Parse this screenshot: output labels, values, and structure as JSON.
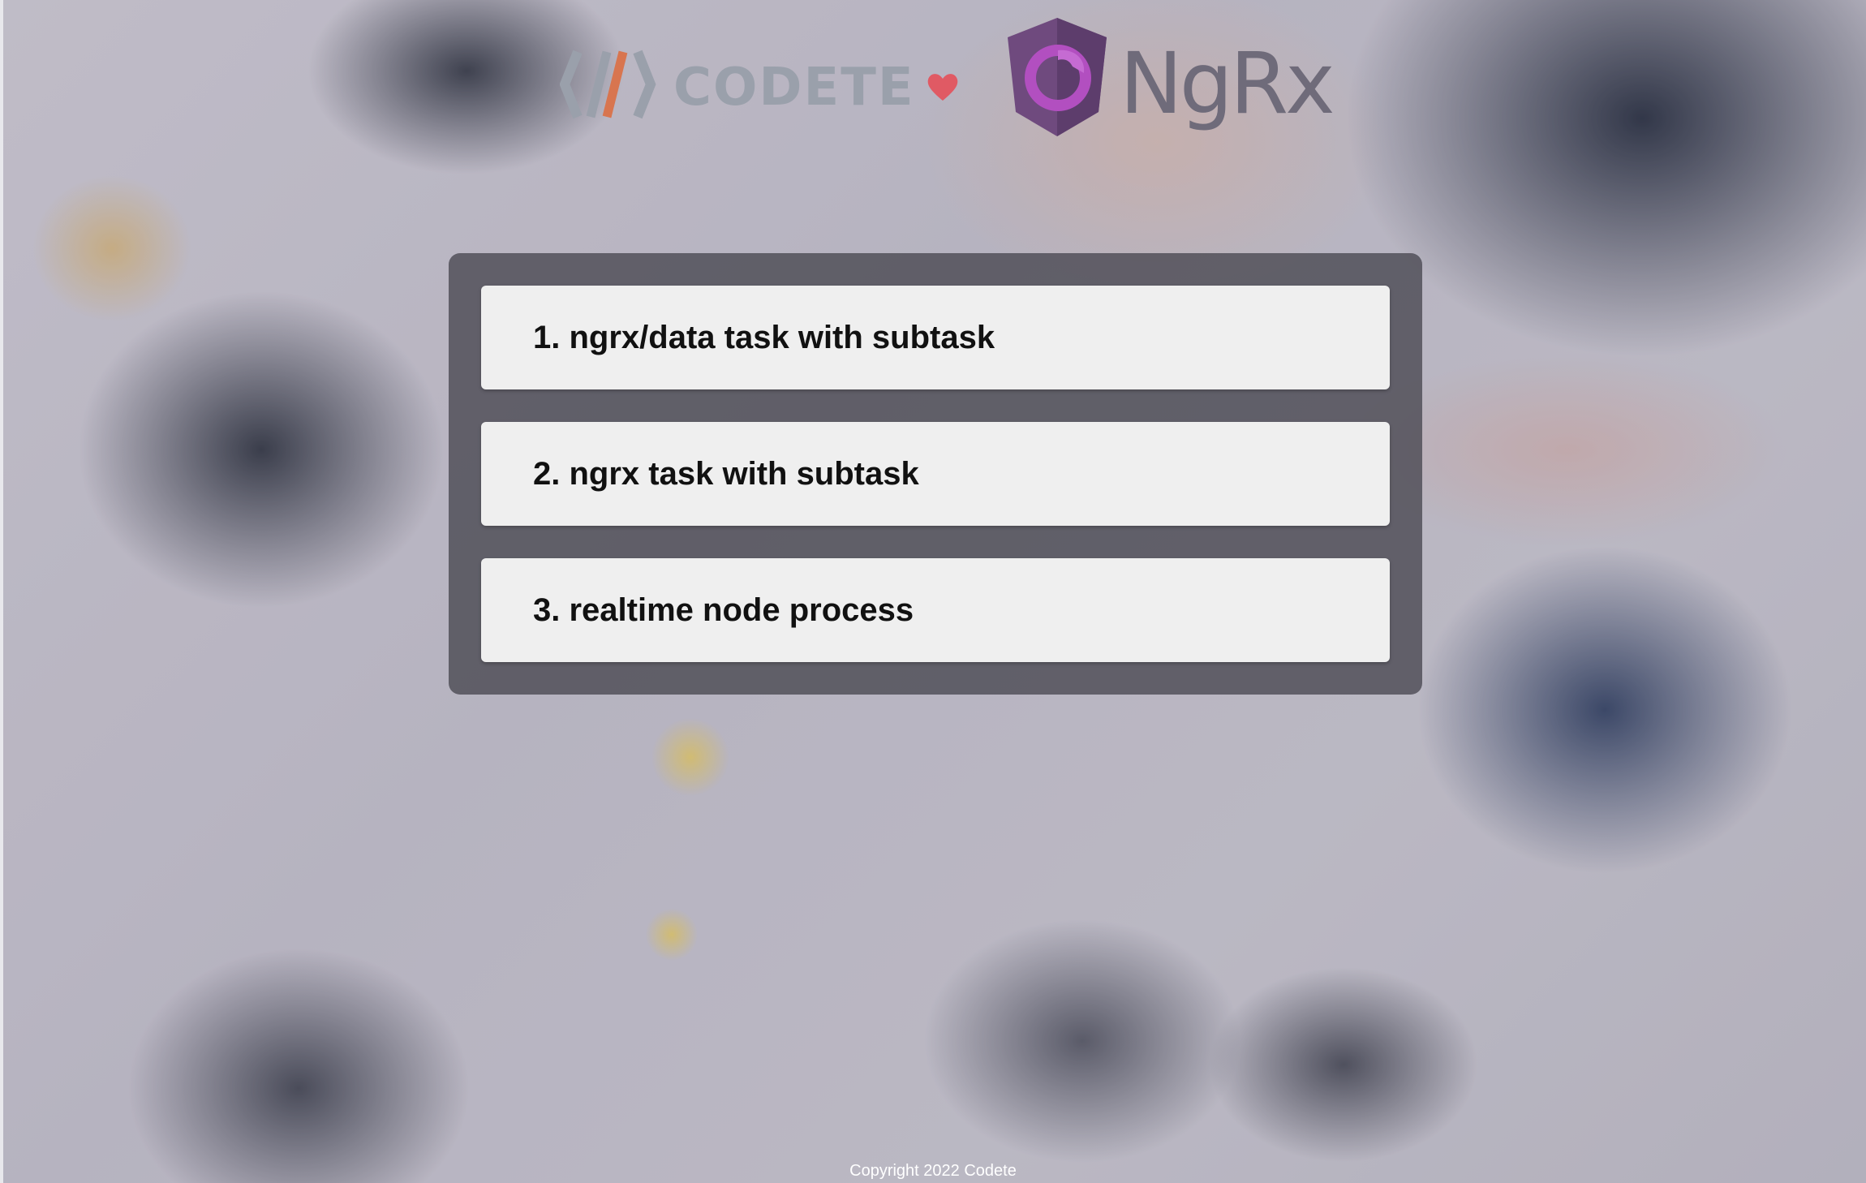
{
  "header": {
    "codete_text": "CODETE",
    "ngrx_text": "NgRx",
    "colors": {
      "codete_gray": "#9aa0ab",
      "codete_accent": "#d8754f",
      "heart": "#e05a64",
      "ngrx_purple": "#7a4a8c",
      "ngrx_accent": "#b24fc0"
    },
    "icons": [
      "codete-logo-icon",
      "heart-icon",
      "ngrx-logo-icon"
    ]
  },
  "tasks": [
    {
      "number": "1.",
      "title_bold": "ngrx/data task",
      "title_rest": "with subtask"
    },
    {
      "number": "2.",
      "title_bold": "ngrx task",
      "title_rest": "with subtask"
    },
    {
      "number": "3.",
      "title_bold": "realtime",
      "title_rest": "node process"
    }
  ],
  "footer": {
    "copyright": "Copyright 2022 Codete"
  }
}
